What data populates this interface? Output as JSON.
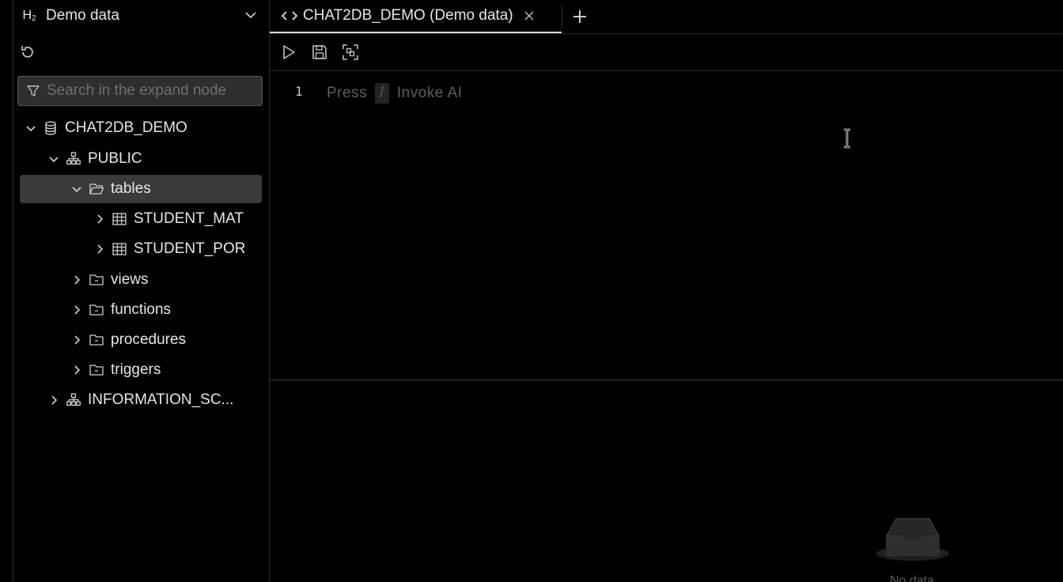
{
  "database_selector": {
    "badge_main": "H",
    "badge_sub": "2",
    "name": "Demo data"
  },
  "search": {
    "placeholder": "Search in the expand node"
  },
  "tree": {
    "database": "CHAT2DB_DEMO",
    "schema_public": "PUBLIC",
    "folder_tables": "tables",
    "table_1": "STUDENT_MAT",
    "table_2": "STUDENT_POR",
    "folder_views": "views",
    "folder_functions": "functions",
    "folder_procedures": "procedures",
    "folder_triggers": "triggers",
    "schema_information": "INFORMATION_SC..."
  },
  "tabs": [
    {
      "label": "CHAT2DB_DEMO (Demo data)"
    }
  ],
  "editor": {
    "line_number": "1",
    "hint_prefix": "Press",
    "hint_key": "/",
    "hint_suffix": "Invoke AI"
  },
  "results": {
    "empty_text": "No data"
  },
  "colors": {
    "background": "#000000",
    "selected_row": "#3a3a3a",
    "placeholder": "#5e5e5e"
  }
}
